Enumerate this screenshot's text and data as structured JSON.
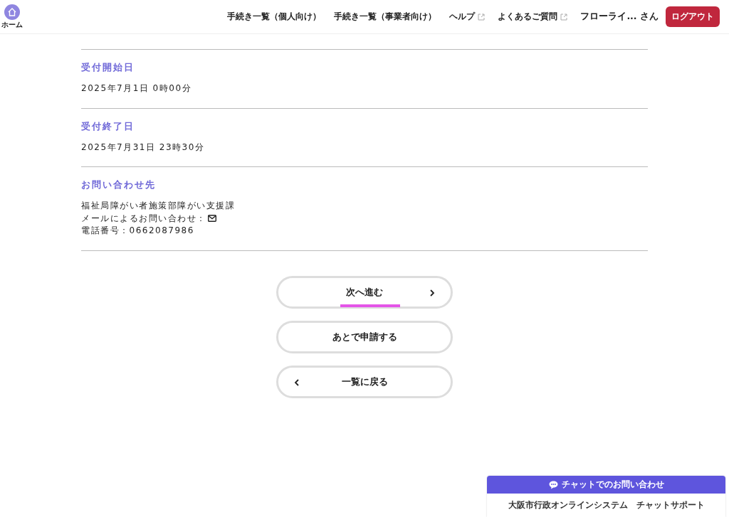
{
  "header": {
    "home_label": "ホーム",
    "nav": [
      {
        "label": "手続き一覧（個人向け）",
        "external": false
      },
      {
        "label": "手続き一覧（事業者向け）",
        "external": false
      },
      {
        "label": "ヘルプ",
        "external": true
      },
      {
        "label": "よくあるご質問",
        "external": true
      }
    ],
    "user": "フローライ... さん",
    "logout": "ログアウト"
  },
  "sections": [
    {
      "title": "受付開始日",
      "lines": [
        "2025年7月1日 0時00分"
      ]
    },
    {
      "title": "受付終了日",
      "lines": [
        "2025年7月31日 23時30分"
      ]
    },
    {
      "title": "お問い合わせ先",
      "lines": [
        "福祉局障がい者施策部障がい支援課",
        "メールによるお問い合わせ：",
        "電話番号：0662087986"
      ]
    }
  ],
  "buttons": [
    {
      "label": "次へ進む",
      "kind": "next",
      "focused": true
    },
    {
      "label": "あとで申請する",
      "kind": "plain",
      "focused": false
    },
    {
      "label": "一覧に戻る",
      "kind": "back",
      "focused": false
    }
  ],
  "chat": {
    "title": "チャットでのお問い合わせ",
    "subtitle": "大阪市行政オンラインシステム　チャットサポート"
  }
}
